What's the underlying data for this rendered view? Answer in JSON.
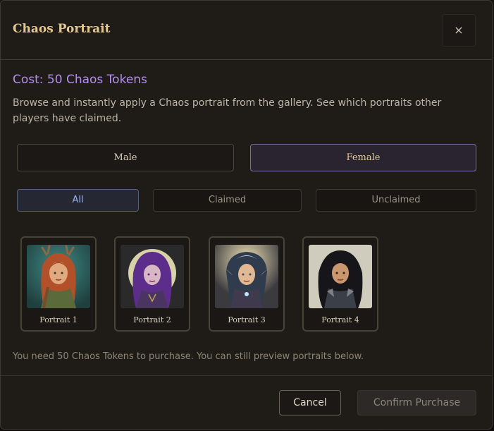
{
  "dialog": {
    "title": "Chaos Portrait",
    "close_label": "×",
    "cost": "Cost: 50 Chaos Tokens",
    "description": "Browse and instantly apply a Chaos portrait from the gallery. See which portraits other players have claimed."
  },
  "gender": {
    "male": "Male",
    "female": "Female",
    "selected": "female"
  },
  "filters": {
    "all": "All",
    "claimed": "Claimed",
    "unclaimed": "Unclaimed",
    "selected": "all"
  },
  "portraits": [
    {
      "label": "Portrait 1"
    },
    {
      "label": "Portrait 2"
    },
    {
      "label": "Portrait 3"
    },
    {
      "label": "Portrait 4"
    }
  ],
  "notice": "You need 50 Chaos Tokens to purchase. You can still preview portraits below.",
  "footer": {
    "cancel": "Cancel",
    "confirm": "Confirm Purchase"
  },
  "colors": {
    "accent_gold": "#e3c893",
    "cost_purple": "#b48ef0",
    "filter_active_blue": "#9bb3f4"
  }
}
